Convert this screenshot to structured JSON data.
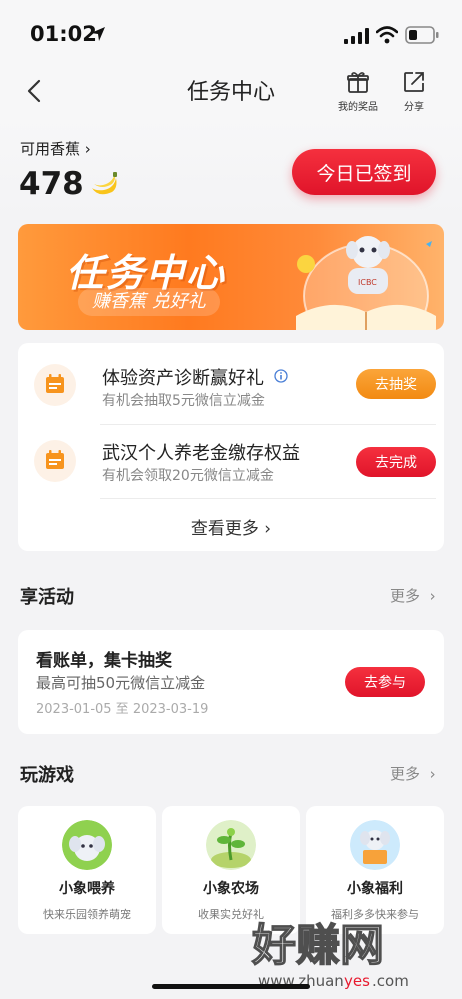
{
  "status": {
    "time": "01:02"
  },
  "nav": {
    "title": "任务中心",
    "prizes_label": "我的奖品",
    "share_label": "分享"
  },
  "balance": {
    "label": "可用香蕉",
    "value": "478",
    "checkin_label": "今日已签到"
  },
  "banner": {
    "title": "任务中心",
    "subtitle": "赚香蕉 兑好礼",
    "badge": "ICBC"
  },
  "tasks": [
    {
      "title": "体验资产诊断赢好礼",
      "desc": "有机会抽取5元微信立减金",
      "button": "去抽奖",
      "button_color": "#f7941d"
    },
    {
      "title": "武汉个人养老金缴存权益",
      "desc": "有机会领取20元微信立减金",
      "button": "去完成",
      "button_color": "#e8192e"
    }
  ],
  "tasks_more": "查看更多",
  "activities": {
    "section_title": "享活动",
    "more": "更多",
    "item": {
      "title": "看账单，集卡抽奖",
      "desc": "最高可抽50元微信立减金",
      "date": "2023-01-05 至 2023-03-19",
      "button": "去参与"
    }
  },
  "games": {
    "section_title": "玩游戏",
    "more": "更多",
    "items": [
      {
        "name": "小象喂养",
        "desc": "快来乐园领养萌宠"
      },
      {
        "name": "小象农场",
        "desc": "收果实兑好礼"
      },
      {
        "name": "小象福利",
        "desc": "福利多多快来参与"
      }
    ]
  },
  "watermark": {
    "text": "好赚网",
    "url": "www.zhuanyes.com"
  },
  "colors": {
    "accent_red": "#e8192e",
    "accent_orange": "#f7941d",
    "background": "#f3f3f5"
  }
}
